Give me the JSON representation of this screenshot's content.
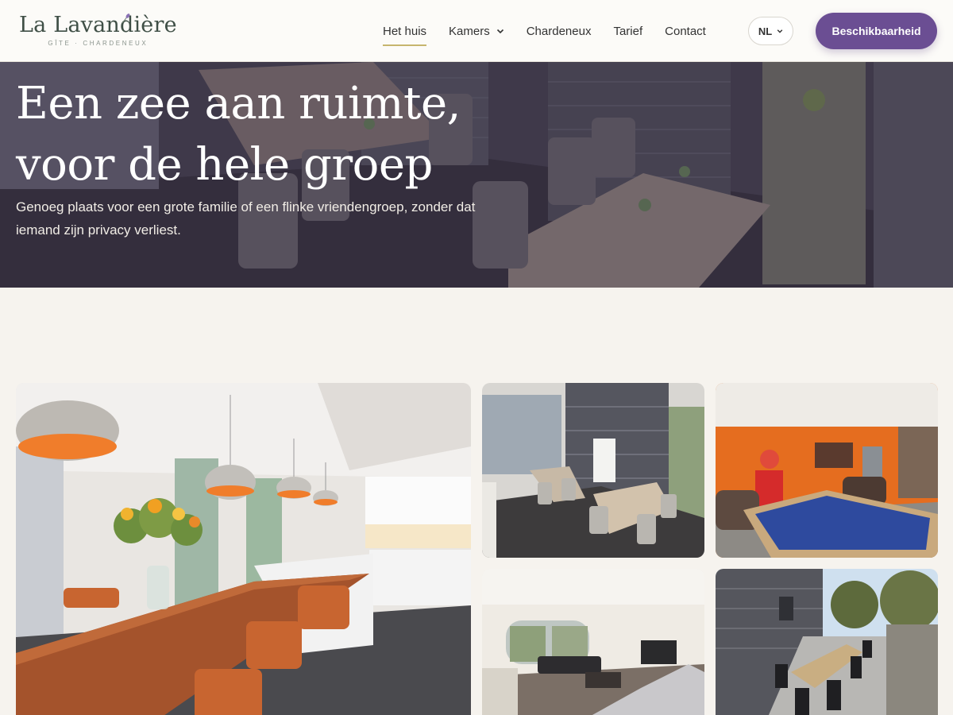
{
  "header": {
    "logo_name": "La Lavandière",
    "logo_sub": "GÎTE · CHARDENEUX",
    "nav": [
      {
        "label": "Het huis",
        "active": true
      },
      {
        "label": "Kamers",
        "has_dropdown": true
      },
      {
        "label": "Chardeneux"
      },
      {
        "label": "Tarief"
      },
      {
        "label": "Contact"
      }
    ],
    "language": "NL",
    "cta_label": "Beschikbaarheid"
  },
  "hero": {
    "title_line1": "Een zee aan ruimte,",
    "title_line2": "voor de hele groep",
    "subtitle": "Genoeg plaats voor een grote familie of een flinke vriendengroep, zonder dat iemand zijn privacy verliest."
  },
  "colors": {
    "accent_purple": "#6b4e93",
    "nav_underline": "#c6b56e",
    "background": "#f6f3ee"
  }
}
